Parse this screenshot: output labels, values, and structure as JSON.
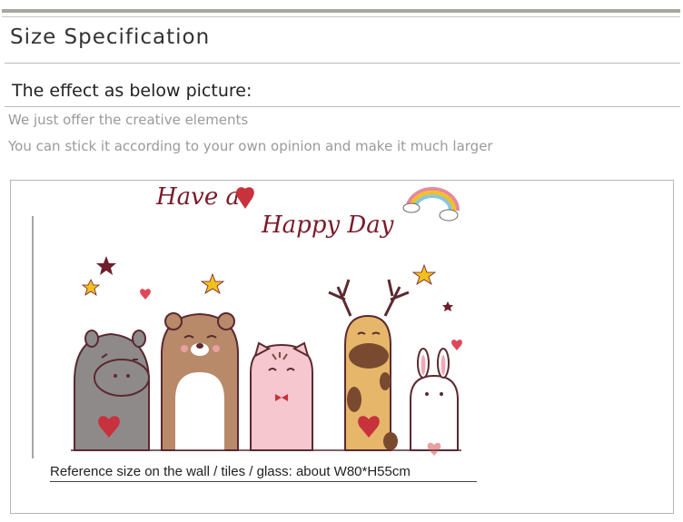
{
  "section_title": "Size Specification",
  "effect_title": "The effect as below picture:",
  "lines": [
    "We just offer the creative elements",
    "You can stick it according to your own opinion and make it much larger"
  ],
  "illustration": {
    "headline_1": "Have a",
    "headline_2": "Happy Day"
  },
  "caption": "Reference size on the wall / tiles / glass: about  W80*H55cm",
  "colors": {
    "text_dark": "#7a1a2a",
    "heart": "#c8323c",
    "star": "#f3c01e"
  }
}
